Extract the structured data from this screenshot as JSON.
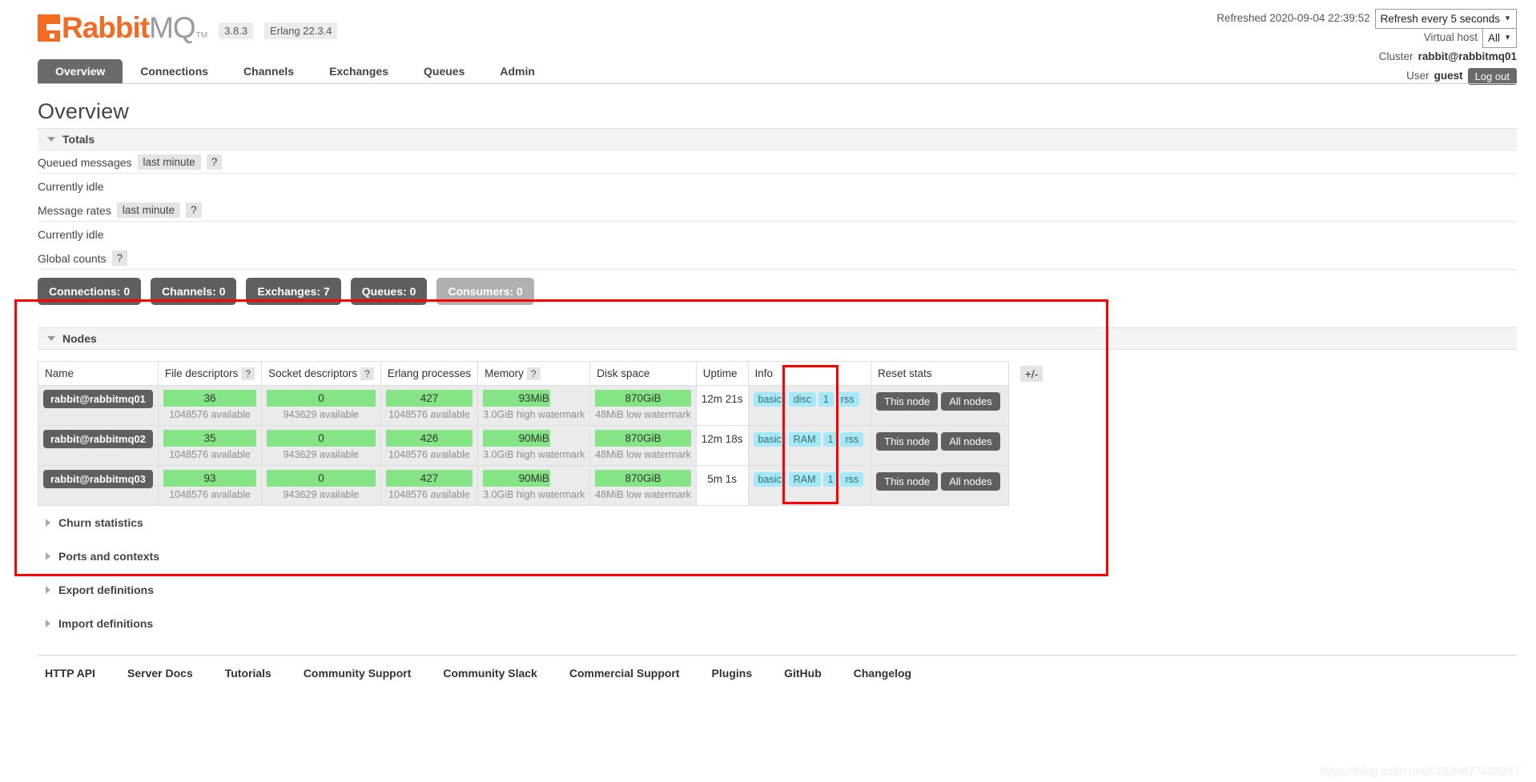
{
  "brand": {
    "name_rabbit": "Rabbit",
    "name_mq": "MQ",
    "tm": "TM",
    "version": "3.8.3",
    "erlang": "Erlang 22.3.4"
  },
  "status": {
    "refreshed_label": "Refreshed 2020-09-04 22:39:52",
    "refresh_select": "Refresh every 5 seconds",
    "vhost_label": "Virtual host",
    "vhost_select": "All",
    "cluster_label": "Cluster",
    "cluster_value": "rabbit@rabbitmq01",
    "user_label": "User",
    "user_value": "guest",
    "logout": "Log out"
  },
  "nav": {
    "tabs": [
      {
        "label": "Overview",
        "active": true
      },
      {
        "label": "Connections",
        "active": false
      },
      {
        "label": "Channels",
        "active": false
      },
      {
        "label": "Exchanges",
        "active": false
      },
      {
        "label": "Queues",
        "active": false
      },
      {
        "label": "Admin",
        "active": false
      }
    ]
  },
  "page": {
    "title": "Overview"
  },
  "totals": {
    "section_label": "Totals",
    "queued_label": "Queued messages",
    "queued_period": "last minute",
    "queued_help": "?",
    "queued_idle": "Currently idle",
    "rates_label": "Message rates",
    "rates_period": "last minute",
    "rates_help": "?",
    "rates_idle": "Currently idle",
    "global_counts_label": "Global counts",
    "global_counts_help": "?",
    "counts": [
      {
        "label": "Connections: 0",
        "muted": false
      },
      {
        "label": "Channels: 0",
        "muted": false
      },
      {
        "label": "Exchanges: 7",
        "muted": false
      },
      {
        "label": "Queues: 0",
        "muted": false
      },
      {
        "label": "Consumers: 0",
        "muted": true
      }
    ]
  },
  "nodes": {
    "section_label": "Nodes",
    "columns": [
      {
        "label": "Name",
        "help": ""
      },
      {
        "label": "File descriptors",
        "help": "?"
      },
      {
        "label": "Socket descriptors",
        "help": "?"
      },
      {
        "label": "Erlang processes",
        "help": ""
      },
      {
        "label": "Memory",
        "help": "?"
      },
      {
        "label": "Disk space",
        "help": ""
      },
      {
        "label": "Uptime",
        "help": ""
      },
      {
        "label": "Info",
        "help": ""
      },
      {
        "label": "Reset stats",
        "help": ""
      }
    ],
    "plus_minus": "+/-",
    "rows": [
      {
        "name": "rabbit@rabbitmq01",
        "file_descriptors": {
          "value": "36",
          "sub": "1048576 available"
        },
        "socket_descriptors": {
          "value": "0",
          "sub": "943629 available"
        },
        "erlang_processes": {
          "value": "427",
          "sub": "1048576 available"
        },
        "memory": {
          "value": "93MiB",
          "sub": "3.0GiB high watermark"
        },
        "disk_space": {
          "value": "870GiB",
          "sub": "48MiB low watermark"
        },
        "uptime": "12m 21s",
        "info_tags": [
          "basic",
          "disc",
          "1",
          "rss"
        ],
        "reset": {
          "this_node": "This node",
          "all_nodes": "All nodes"
        }
      },
      {
        "name": "rabbit@rabbitmq02",
        "file_descriptors": {
          "value": "35",
          "sub": "1048576 available"
        },
        "socket_descriptors": {
          "value": "0",
          "sub": "943629 available"
        },
        "erlang_processes": {
          "value": "426",
          "sub": "1048576 available"
        },
        "memory": {
          "value": "90MiB",
          "sub": "3.0GiB high watermark"
        },
        "disk_space": {
          "value": "870GiB",
          "sub": "48MiB low watermark"
        },
        "uptime": "12m 18s",
        "info_tags": [
          "basic",
          "RAM",
          "1",
          "rss"
        ],
        "reset": {
          "this_node": "This node",
          "all_nodes": "All nodes"
        }
      },
      {
        "name": "rabbit@rabbitmq03",
        "file_descriptors": {
          "value": "93",
          "sub": "1048576 available"
        },
        "socket_descriptors": {
          "value": "0",
          "sub": "943629 available"
        },
        "erlang_processes": {
          "value": "427",
          "sub": "1048576 available"
        },
        "memory": {
          "value": "90MiB",
          "sub": "3.0GiB high watermark"
        },
        "disk_space": {
          "value": "870GiB",
          "sub": "48MiB low watermark"
        },
        "uptime": "5m 1s",
        "info_tags": [
          "basic",
          "RAM",
          "1",
          "rss"
        ],
        "reset": {
          "this_node": "This node",
          "all_nodes": "All nodes"
        }
      }
    ]
  },
  "collapsed_sections": [
    {
      "label": "Churn statistics"
    },
    {
      "label": "Ports and contexts"
    },
    {
      "label": "Export definitions"
    },
    {
      "label": "Import definitions"
    }
  ],
  "footer": {
    "links": [
      "HTTP API",
      "Server Docs",
      "Tutorials",
      "Community Support",
      "Community Slack",
      "Commercial Support",
      "Plugins",
      "GitHub",
      "Changelog"
    ]
  },
  "watermark": "https://blog.csdn.net/CSDN877425287",
  "annotation": {
    "color": "#ff0000"
  }
}
